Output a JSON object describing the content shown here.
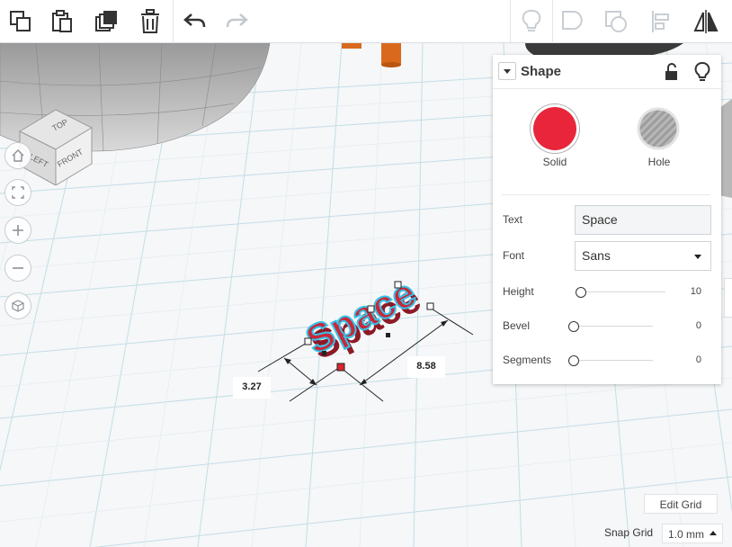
{
  "toolbar": {
    "buttons": [
      {
        "name": "copy-button",
        "icon": "copy-icon"
      },
      {
        "name": "paste-button",
        "icon": "paste-icon"
      },
      {
        "name": "duplicate-button",
        "icon": "duplicate-icon"
      },
      {
        "name": "delete-button",
        "icon": "trash-icon"
      },
      {
        "name": "undo-button",
        "icon": "undo-icon"
      },
      {
        "name": "redo-button",
        "icon": "redo-icon"
      },
      {
        "name": "show-all-button",
        "icon": "lightbulb-icon"
      },
      {
        "name": "group-button",
        "icon": "group-icon"
      },
      {
        "name": "ungroup-button",
        "icon": "ungroup-icon"
      },
      {
        "name": "align-button",
        "icon": "align-icon"
      },
      {
        "name": "mirror-button",
        "icon": "mirror-icon"
      }
    ]
  },
  "viewcube": {
    "top": "TOP",
    "left": "LEFT",
    "front": "FRONT"
  },
  "view_controls": [
    "home-icon",
    "fit-icon",
    "zoom-in-icon",
    "zoom-out-icon",
    "perspective-icon"
  ],
  "shape_panel": {
    "title": "Shape",
    "solid_label": "Solid",
    "hole_label": "Hole",
    "solid_color": "#e8253a",
    "properties": {
      "text_label": "Text",
      "text_value": "Space",
      "font_label": "Font",
      "font_value": "Sans",
      "height_label": "Height",
      "height_value": "10",
      "height_fraction": 0.0,
      "bevel_label": "Bevel",
      "bevel_value": "0",
      "bevel_fraction": 0.0,
      "segments_label": "Segments",
      "segments_value": "0",
      "segments_fraction": 0.0
    }
  },
  "scene": {
    "text_object": "Space",
    "object_color": "#c8283a",
    "selection_color": "#36c3e8"
  },
  "dimensions": {
    "width": "3.27",
    "length": "8.58"
  },
  "grid": {
    "edit_label": "Edit Grid",
    "snap_label": "Snap Grid",
    "snap_value": "1.0 mm"
  }
}
